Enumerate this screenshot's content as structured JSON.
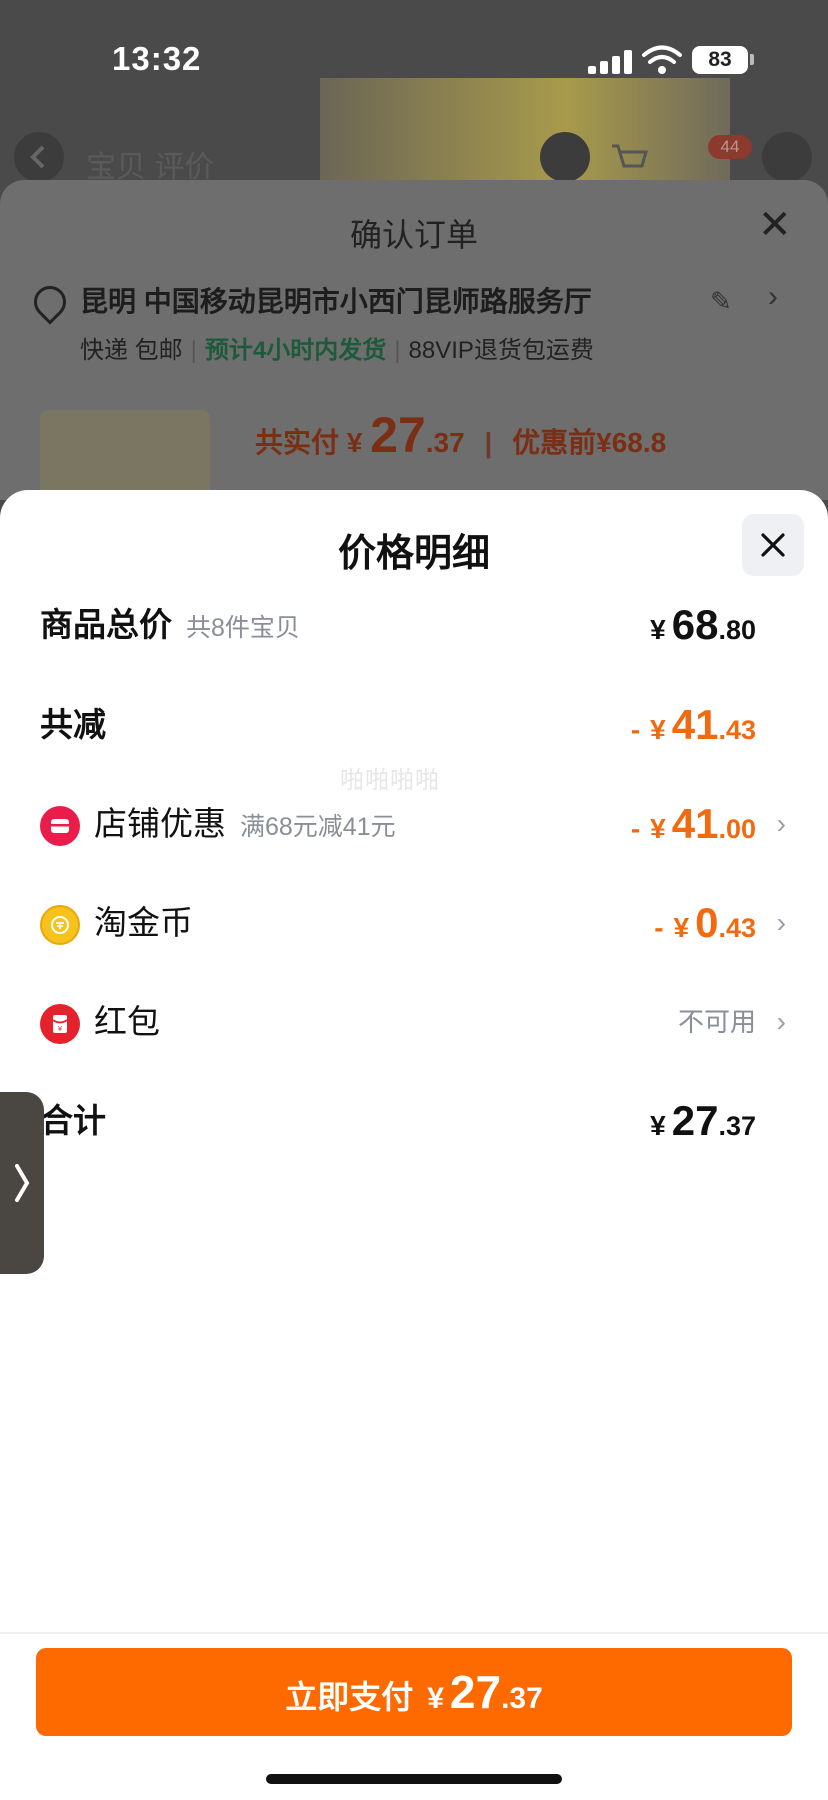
{
  "status_bar": {
    "time": "13:32",
    "battery": "83"
  },
  "background_app": {
    "nav_tabs": "宝贝  评价",
    "cart_badge": "44",
    "order_sheet": {
      "title": "确认订单",
      "address": "昆明 中国移动昆明市小西门昆师路服务厅",
      "shipping_method": "快递 包邮",
      "shipping_eta": "预计4小时内发货",
      "return_policy": "88VIP退货包运费",
      "total_label": "共实付",
      "total_currency": "¥",
      "total_integer": "27",
      "total_decimal": ".37",
      "before_discount": "优惠前¥68.8"
    }
  },
  "price_detail": {
    "title": "价格明细",
    "rows": {
      "goods_total": {
        "label": "商品总价",
        "sub": "共8件宝贝",
        "currency": "¥",
        "integer": "68",
        "decimal": ".80"
      },
      "total_reduction": {
        "label": "共减",
        "minus": "-",
        "currency": "¥",
        "integer": "41",
        "decimal": ".43"
      },
      "shop_discount": {
        "label": "店铺优惠",
        "sub": "满68元减41元",
        "minus": "-",
        "currency": "¥",
        "integer": "41",
        "decimal": ".00"
      },
      "tao_coin": {
        "label": "淘金币",
        "minus": "-",
        "currency": "¥",
        "integer": "0",
        "decimal": ".43"
      },
      "red_packet": {
        "label": "红包",
        "status": "不可用"
      },
      "sum": {
        "label": "合计",
        "currency": "¥",
        "integer": "27",
        "decimal": ".37"
      }
    },
    "watermark": "啪啪啪啪"
  },
  "pay_button": {
    "label": "立即支付",
    "currency": "¥",
    "integer": "27",
    "decimal": ".37"
  },
  "colors": {
    "accent": "#ff6a00",
    "discount": "#f26a10",
    "shop_icon": "#ea1d4a",
    "coin_icon": "#f7c21b",
    "hongbao_icon": "#e5222b"
  }
}
